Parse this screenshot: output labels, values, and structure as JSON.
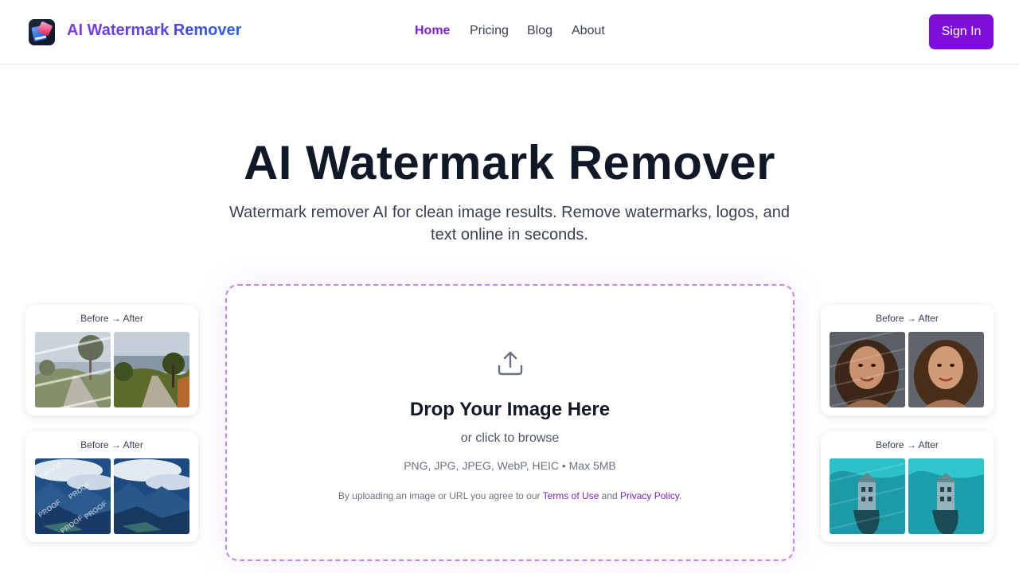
{
  "header": {
    "brand": "AI Watermark Remover",
    "nav": [
      {
        "label": "Home",
        "active": true
      },
      {
        "label": "Pricing",
        "active": false
      },
      {
        "label": "Blog",
        "active": false
      },
      {
        "label": "About",
        "active": false
      }
    ],
    "signin_label": "Sign In"
  },
  "hero": {
    "title": "AI Watermark Remover",
    "subtitle": "Watermark remover AI for clean image results. Remove watermarks, logos, and text online in seconds."
  },
  "upload": {
    "icon": "upload-icon",
    "title": "Drop Your Image Here",
    "browse": "or click to browse",
    "formats": "PNG, JPG, JPEG, WebP, HEIC • Max 5MB",
    "legal_prefix": "By uploading an image or URL you agree to our ",
    "terms": "Terms of Use",
    "legal_and": " and ",
    "privacy": "Privacy Policy",
    "legal_suffix": "."
  },
  "examples": {
    "label": "Before → After",
    "watermark_text": "PROOF",
    "cards": [
      {
        "subject": "tree-lined country road"
      },
      {
        "subject": "aerial mountain landscape"
      },
      {
        "subject": "portrait of a woman"
      },
      {
        "subject": "underwater building"
      }
    ]
  },
  "colors": {
    "accent": "#7e0fd8",
    "active_nav": "#7e22ce",
    "dropzone_border": "#c084fc"
  }
}
